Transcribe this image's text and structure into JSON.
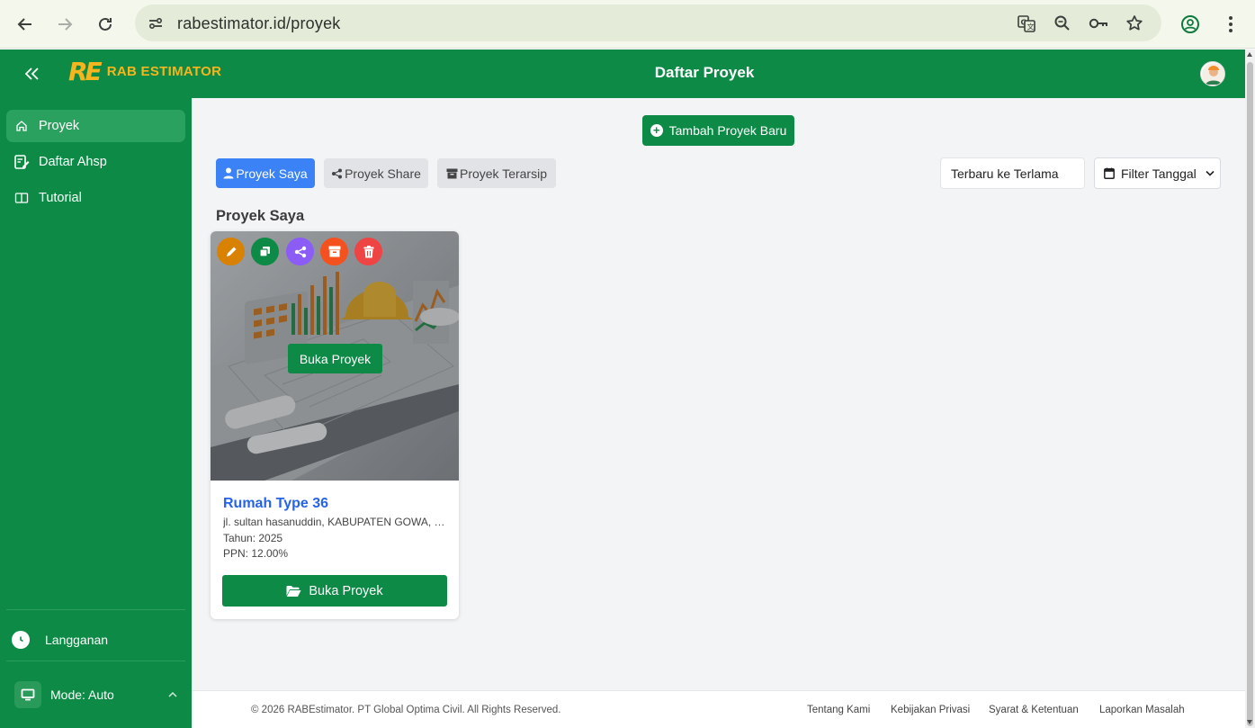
{
  "browser": {
    "url": "rabestimator.id/proyek",
    "icons": [
      "back-icon",
      "forward-icon",
      "reload-icon",
      "site-settings-icon",
      "translate-icon",
      "zoom-icon",
      "password-key-icon",
      "bookmark-star-icon",
      "profile-icon",
      "menu-dots-icon"
    ]
  },
  "header": {
    "logo_mark": "RE",
    "logo_text": "RAB ESTIMATOR",
    "title": "Daftar Proyek"
  },
  "sidebar": {
    "items": [
      {
        "label": "Proyek",
        "icon": "home-icon",
        "active": true
      },
      {
        "label": "Daftar Ahsp",
        "icon": "edit-note-icon",
        "active": false
      },
      {
        "label": "Tutorial",
        "icon": "book-icon",
        "active": false
      }
    ],
    "subscription_label": "Langganan",
    "mode_label": "Mode: Auto"
  },
  "main": {
    "add_button": "Tambah Proyek Baru",
    "tabs": [
      {
        "label": "Proyek Saya",
        "icon": "user-icon",
        "active": true
      },
      {
        "label": "Proyek Share",
        "icon": "share-icon",
        "active": false
      },
      {
        "label": "Proyek Terarsip",
        "icon": "archive-icon",
        "active": false
      }
    ],
    "sort_value": "Terbaru ke Terlama",
    "filter_label": "Filter Tanggal",
    "section_title": "Proyek Saya"
  },
  "project_card": {
    "overlay_button": "Buka Proyek",
    "title": "Rumah Type 36",
    "address": "jl. sultan hasanuddin, KABUPATEN GOWA, SULAWESI SELATAN",
    "year": "Tahun: 2025",
    "ppn": "PPN: 12.00%",
    "open_button": "Buka Proyek",
    "actions": [
      {
        "name": "edit",
        "color": "#d98100"
      },
      {
        "name": "copy",
        "color": "#0d8a45"
      },
      {
        "name": "share",
        "color": "#8b5cf6"
      },
      {
        "name": "archive",
        "color": "#f4511e"
      },
      {
        "name": "delete",
        "color": "#ef4444"
      }
    ]
  },
  "footer": {
    "copyright": "© 2026 RABEstimator. PT Global Optima Civil. All Rights Reserved.",
    "links": [
      "Tentang Kami",
      "Kebijakan Privasi",
      "Syarat & Ketentuan",
      "Laporkan Masalah"
    ]
  },
  "colors": {
    "brand_green": "#0d8a45",
    "accent_yellow": "#f5b51f",
    "tab_active_blue": "#3b82f6",
    "title_blue": "#2563eb"
  }
}
